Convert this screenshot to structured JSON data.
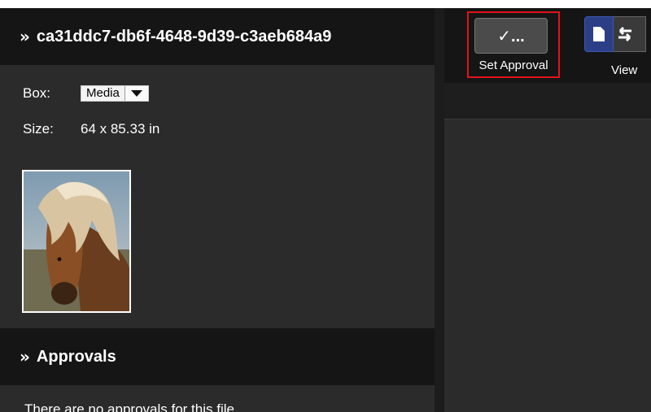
{
  "file": {
    "title": "ca31ddc7-db6f-4648-9d39-c3aeb684a9",
    "box_label": "Box:",
    "box_value": "Media",
    "size_label": "Size:",
    "size_value": "64 x 85.33 in"
  },
  "approvals": {
    "title": "Approvals",
    "empty_message": "There are no approvals for this file"
  },
  "toolbar": {
    "set_approval_icon_text": "✓...",
    "set_approval_label": "Set Approval",
    "view_label": "View"
  },
  "icons": {
    "chevron": "double-chevron-right-icon",
    "approval": "checkmark-ellipsis-icon",
    "page": "page-icon",
    "swap": "swap-arrows-icon"
  },
  "colors": {
    "highlight": "#e2121a",
    "view_accent": "#2c3f86",
    "header_bg": "#151515",
    "panel_bg": "#2b2b2b"
  }
}
